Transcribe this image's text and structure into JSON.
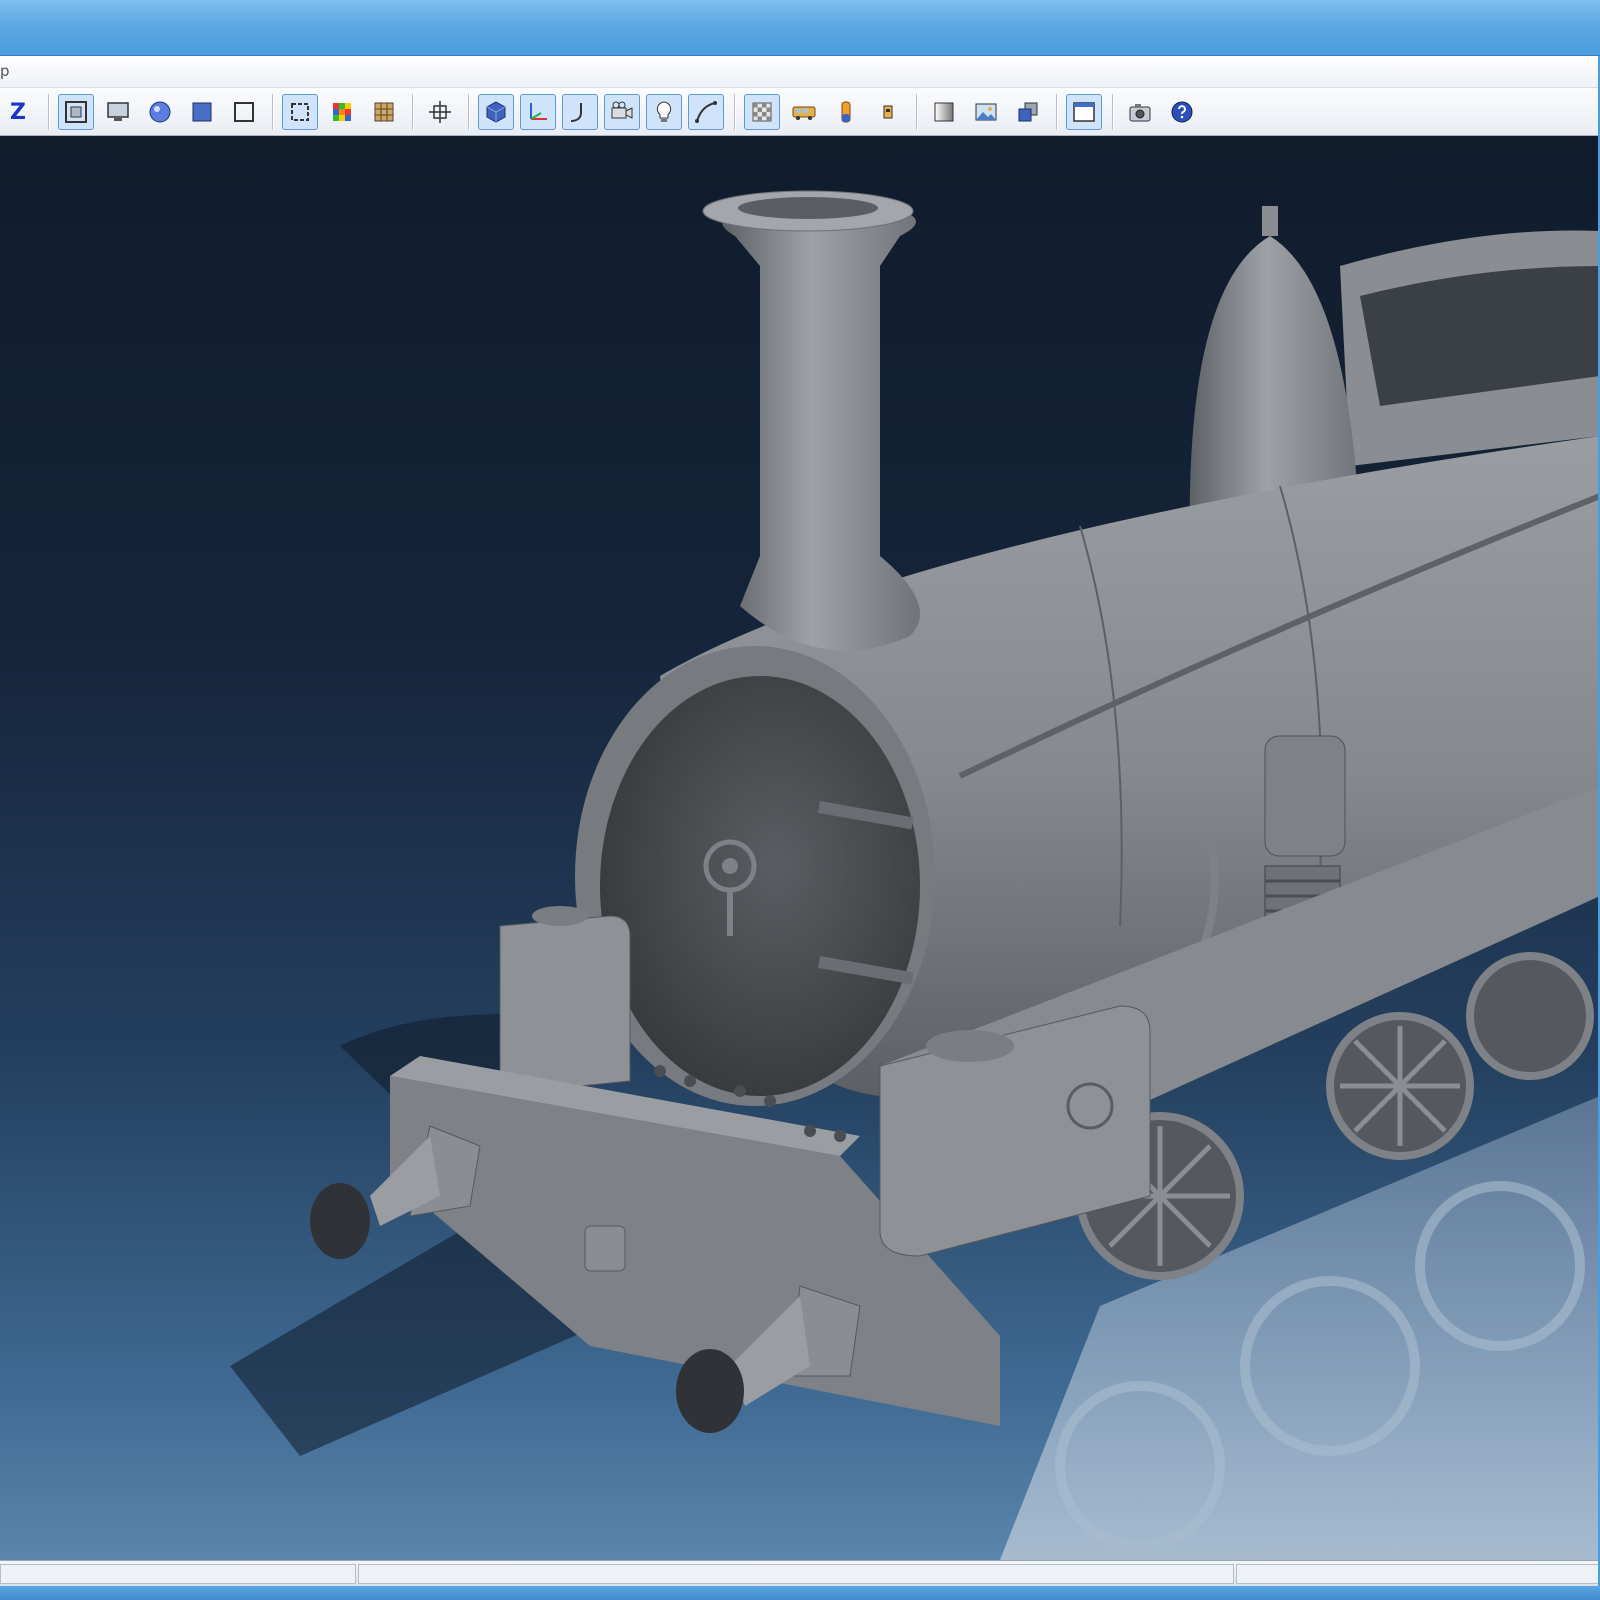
{
  "window": {
    "title": ""
  },
  "menubar": {
    "items": [
      {
        "label": "p"
      }
    ]
  },
  "toolbar": {
    "z_label": "Z",
    "buttons": [
      {
        "name": "zoom-z-button",
        "icon": "z-letter"
      },
      {
        "name": "zoom-all-button",
        "icon": "zoom-extents-icon"
      },
      {
        "name": "screen-view-button",
        "icon": "monitor-icon"
      },
      {
        "name": "sphere-view-button",
        "icon": "sphere-icon"
      },
      {
        "name": "box-view-button",
        "icon": "box-icon"
      },
      {
        "name": "frame-view-button",
        "icon": "frame-icon"
      },
      {
        "name": "select-frame-button",
        "icon": "select-frame-icon"
      },
      {
        "name": "color-cube-button",
        "icon": "rubik-cube-icon"
      },
      {
        "name": "texture-cube-button",
        "icon": "texture-cube-icon"
      },
      {
        "name": "crosshair-button",
        "icon": "crosshair-icon"
      },
      {
        "name": "solid-cube-button",
        "icon": "solid-cube-icon"
      },
      {
        "name": "axes-button",
        "icon": "axes-icon"
      },
      {
        "name": "bend-tool-button",
        "icon": "bend-icon"
      },
      {
        "name": "camera-view-button",
        "icon": "video-camera-icon"
      },
      {
        "name": "light-button",
        "icon": "lightbulb-icon"
      },
      {
        "name": "curve-button",
        "icon": "curve-icon"
      },
      {
        "name": "checker-button",
        "icon": "checker-icon"
      },
      {
        "name": "vehicle-button",
        "icon": "bus-icon"
      },
      {
        "name": "material-button",
        "icon": "cylinder-icon"
      },
      {
        "name": "object-button",
        "icon": "small-object-icon"
      },
      {
        "name": "gradient-bg-button",
        "icon": "gradient-square-icon"
      },
      {
        "name": "image-bg-button",
        "icon": "picture-icon"
      },
      {
        "name": "layers-button",
        "icon": "layers-icon"
      },
      {
        "name": "window-mode-button",
        "icon": "window-icon"
      },
      {
        "name": "screenshot-button",
        "icon": "photo-camera-icon"
      },
      {
        "name": "help-button",
        "icon": "help-icon"
      }
    ]
  },
  "viewport": {
    "subject": "steam-locomotive-3d-model",
    "background_top": "#101c2c",
    "background_bottom": "#5a86ad",
    "model_color": "#7e8286"
  },
  "statusbar": {
    "panes": [
      {
        "text": ""
      },
      {
        "text": ""
      },
      {
        "text": ""
      }
    ]
  }
}
